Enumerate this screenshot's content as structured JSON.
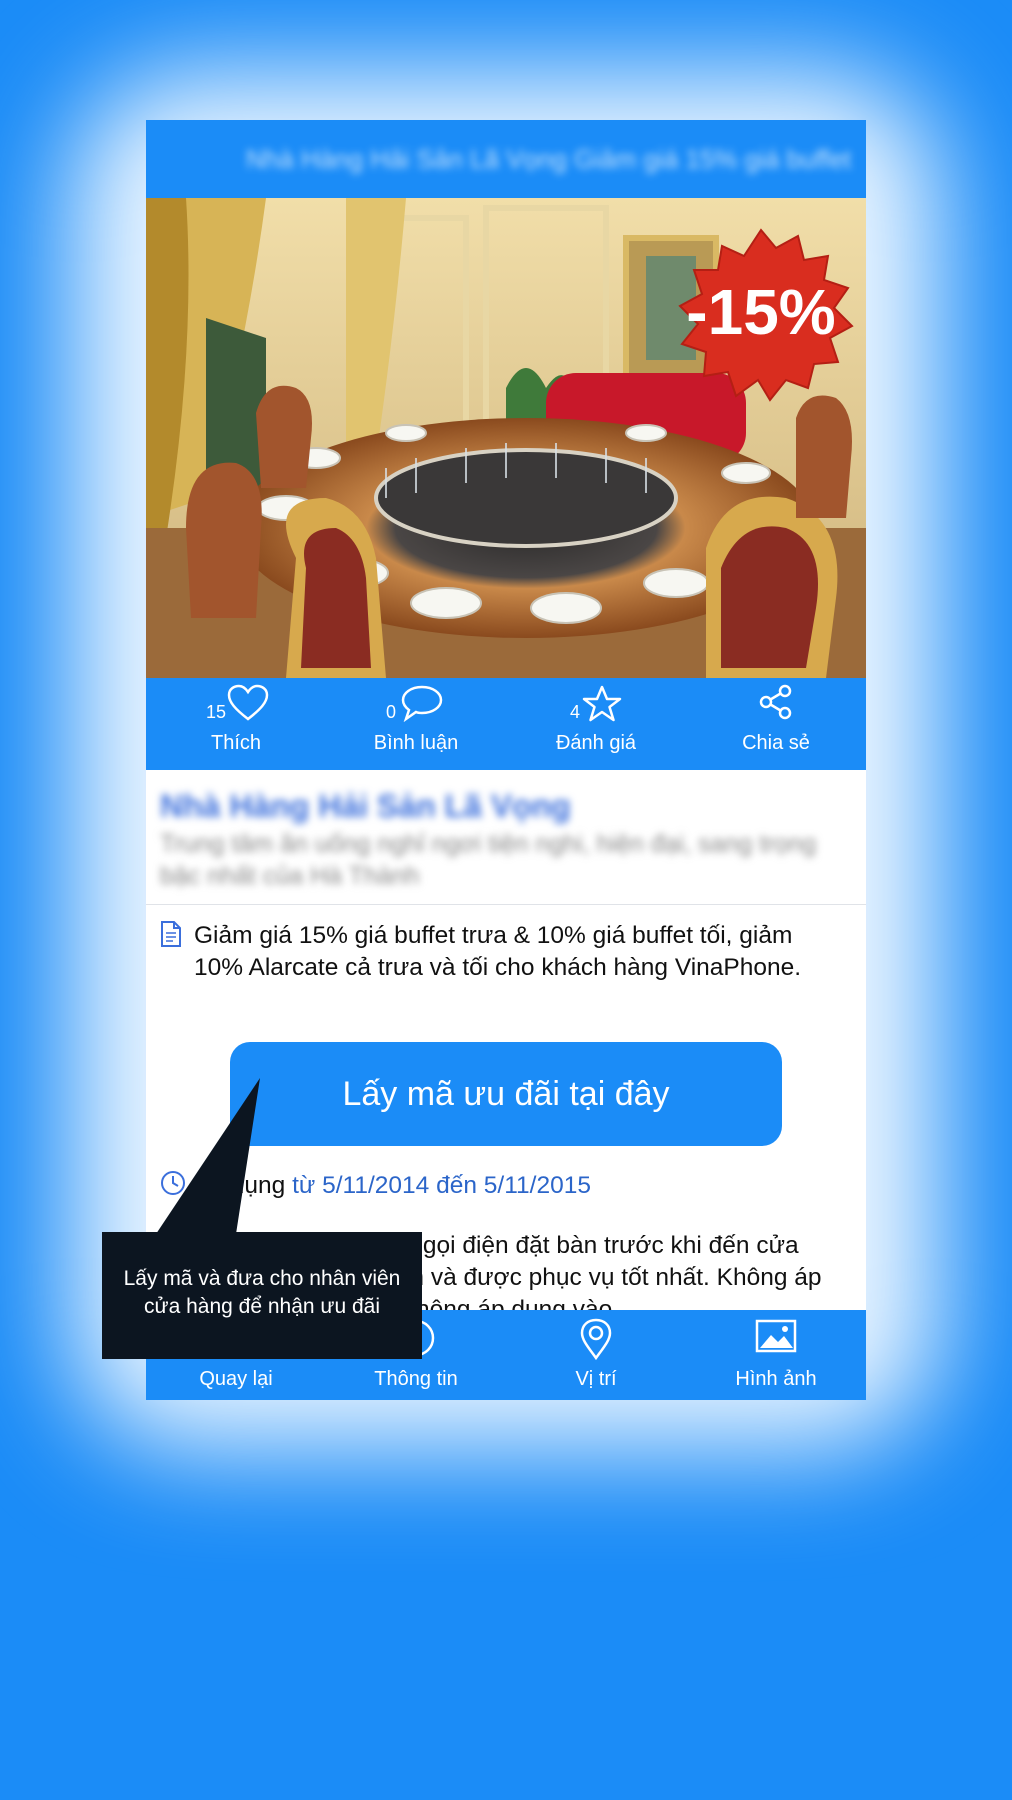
{
  "header": {
    "title": "Nhà Hàng Hải Sản Lã Vọng Giảm giá 15% giá buffet"
  },
  "hero": {
    "badge_text": "-15%"
  },
  "actions": [
    {
      "count": "15",
      "label": "Thích",
      "icon": "heart-icon"
    },
    {
      "count": "0",
      "label": "Bình luận",
      "icon": "comment-icon"
    },
    {
      "count": "4",
      "label": "Đánh giá",
      "icon": "star-icon"
    },
    {
      "count": "",
      "label": "Chia sẻ",
      "icon": "share-icon"
    }
  ],
  "shop": {
    "name": "Nhà Hàng Hải Sản Lã Vọng",
    "description": "Trung tâm ăn uống nghỉ ngơi tiện nghi, hiện đại, sang trọng bậc nhất của Hà Thành"
  },
  "offer": {
    "description": "Giảm giá 15% giá buffet trưa & 10% giá buffet tối, giảm 10% Alarcate cả trưa và tối cho khách hàng VinaPhone.",
    "cta_label": "Lấy mã ưu đãi tại đây",
    "apply_prefix": "Áp dụng",
    "apply_range": "từ 5/11/2014 đến 5/11/2015",
    "note": "Khách hàng vui lòng gọi điện đặt bàn trước khi đến cửa hàng để được tư vấn và được phục vụ tốt nhất. Không áp dụng cho đồ uống, không áp dụng vào"
  },
  "bottom_nav": [
    {
      "label": "Quay lại",
      "icon": "back-icon"
    },
    {
      "label": "Thông tin",
      "icon": "info-icon"
    },
    {
      "label": "Vị trí",
      "icon": "location-pin-icon"
    },
    {
      "label": "Hình ảnh",
      "icon": "image-icon"
    }
  ],
  "tooltip": {
    "line1": "Lấy mã và đưa cho nhân viên",
    "line2": "cửa hàng để nhận ưu đãi"
  },
  "colors": {
    "accent": "#1b8cf7",
    "date_link": "#2b65c9",
    "badge": "#d92d1f"
  }
}
